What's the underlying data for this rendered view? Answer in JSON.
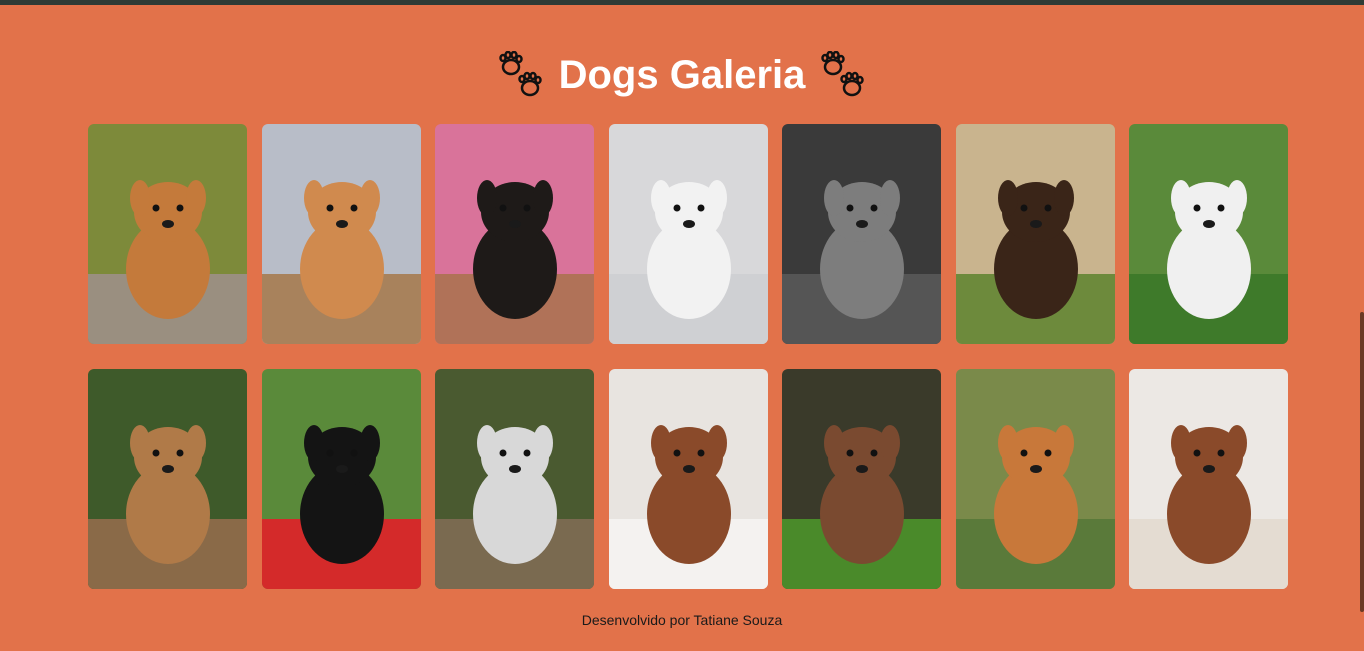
{
  "page": {
    "title": "Dogs Galeria",
    "footer": "Desenvolvido por Tatiane Souza"
  },
  "colors": {
    "background": "#e2724a",
    "top_bar": "#2e3b36",
    "title": "#ffffff",
    "paw": "#e2724a",
    "paw_outline": "#111111"
  },
  "icons": {
    "left_paw": "paw-prints-icon",
    "right_paw": "paw-prints-icon"
  },
  "gallery": {
    "photos": [
      {
        "name": "corgi-jumping",
        "bg": "#7d8a3a",
        "fg": "#c47a3b",
        "ground": "#9a8f80"
      },
      {
        "name": "bulldog-puppy",
        "bg": "#b8bdc8",
        "fg": "#d08a4e",
        "ground": "#a8825c"
      },
      {
        "name": "dachshund-puppy",
        "bg": "#d9739a",
        "fg": "#1e1a18",
        "ground": "#b07258"
      },
      {
        "name": "white-puppy",
        "bg": "#d8d8da",
        "fg": "#f2f2f2",
        "ground": "#cfd0d3"
      },
      {
        "name": "weimaraner-puppy",
        "bg": "#3a3a3a",
        "fg": "#7d7d7d",
        "ground": "#555555"
      },
      {
        "name": "tibetan-mastiff",
        "bg": "#c9b48e",
        "fg": "#3a2518",
        "ground": "#6d8a3c"
      },
      {
        "name": "samoyed-running",
        "bg": "#5a8a3a",
        "fg": "#f0f0f0",
        "ground": "#3e7a2a"
      },
      {
        "name": "yorkshire-running",
        "bg": "#3e5a2a",
        "fg": "#b07a48",
        "ground": "#8a6a48"
      },
      {
        "name": "cocker-spaniel-bucket",
        "bg": "#5a8a3a",
        "fg": "#141414",
        "ground": "#d42a2a"
      },
      {
        "name": "husky-running",
        "bg": "#4a5a30",
        "fg": "#d8d8d8",
        "ground": "#7a6a50"
      },
      {
        "name": "sleeping-puppy",
        "bg": "#e8e4e0",
        "fg": "#8a4a2a",
        "ground": "#f4f2f0"
      },
      {
        "name": "australian-shepherd",
        "bg": "#3a3a2a",
        "fg": "#7a4a30",
        "ground": "#4a8a2a"
      },
      {
        "name": "corgi-lying",
        "bg": "#7a8a4a",
        "fg": "#c8783a",
        "ground": "#5a7a3a"
      },
      {
        "name": "cavalier-spaniel",
        "bg": "#ece8e4",
        "fg": "#8a4a2a",
        "ground": "#e4dcd2"
      }
    ]
  }
}
